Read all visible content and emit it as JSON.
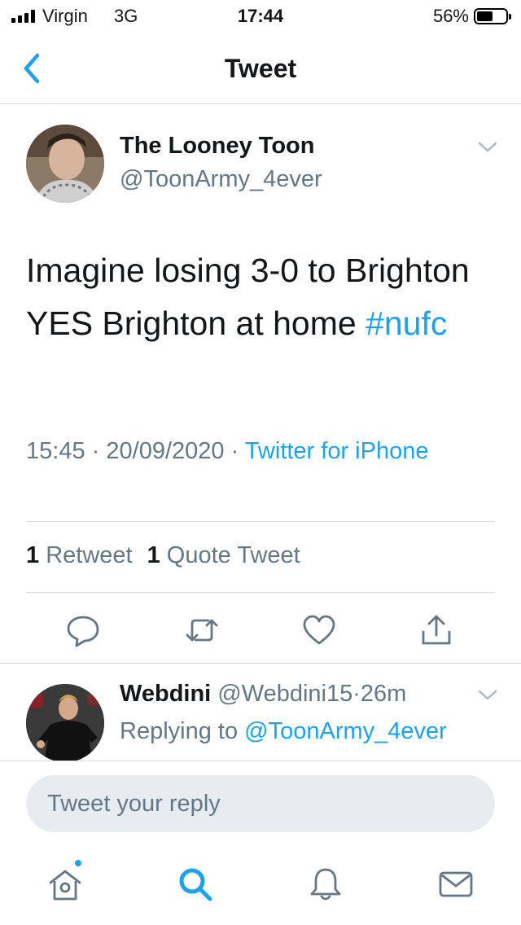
{
  "status_bar": {
    "carrier": "Virgin",
    "network": "3G",
    "time": "17:44",
    "battery_percent": "56%",
    "battery_level": 0.56
  },
  "nav": {
    "title": "Tweet",
    "back_icon": "chevron-left-icon"
  },
  "tweet": {
    "display_name": "The Looney Toon",
    "handle": "@ToonArmy_4ever",
    "text": "Imagine losing 3-0 to Brighton YES Brighton at home ",
    "hashtag": "#nufc",
    "time": "15:45",
    "date": "20/09/2020",
    "separator": "·",
    "source": "Twitter for iPhone",
    "retweet_count": "1",
    "retweet_label": "Retweet",
    "quote_count": "1",
    "quote_label": "Quote Tweet"
  },
  "actions": [
    {
      "icon": "reply-icon"
    },
    {
      "icon": "retweet-icon"
    },
    {
      "icon": "like-icon"
    },
    {
      "icon": "share-icon"
    }
  ],
  "reply": {
    "display_name": "Webdini",
    "handle": "@Webdini15",
    "separator": "·",
    "time_ago": "26m",
    "replying_prefix": "Replying to",
    "replying_to": "@ToonArmy_4ever"
  },
  "composer": {
    "placeholder": "Tweet your reply"
  },
  "tab_bar": [
    {
      "icon": "home-icon",
      "has_badge": true
    },
    {
      "icon": "search-icon",
      "active": true
    },
    {
      "icon": "notifications-icon"
    },
    {
      "icon": "messages-icon"
    }
  ],
  "colors": {
    "accent": "#1da1f2",
    "secondary_text": "#657786",
    "primary_text": "#14171a",
    "divider": "#d9dde1",
    "input_bg": "#e6ecf0"
  }
}
